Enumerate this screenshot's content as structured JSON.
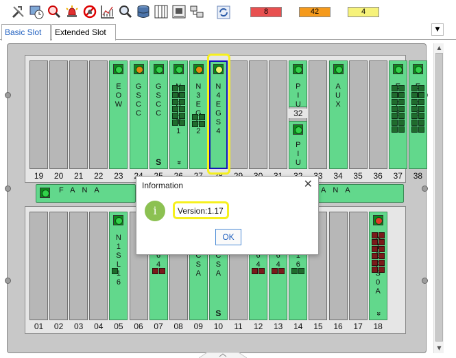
{
  "toolbar": {
    "icons": [
      "tools-icon",
      "clock-monitor-icon",
      "alarm-search-icon",
      "alarm-bell-icon",
      "alarm-filter-icon",
      "performance-chart-icon",
      "search-icon",
      "database-icon",
      "columns-icon",
      "config-icon",
      "network-icon",
      "refresh-icon"
    ],
    "alarms": {
      "critical": {
        "count": "8",
        "color": "#e85050"
      },
      "major": {
        "count": "42",
        "color": "#f59a1c"
      },
      "minor": {
        "count": "4",
        "color": "#f6f27a"
      }
    }
  },
  "tabs": {
    "basic": "Basic Slot",
    "extended": "Extended Slot"
  },
  "chassis": {
    "top_slot_numbers": [
      "19",
      "20",
      "21",
      "22",
      "23",
      "24",
      "25",
      "26",
      "27",
      "28",
      "29",
      "30",
      "31",
      "32",
      "33",
      "34",
      "35",
      "36",
      "37",
      "38"
    ],
    "bottom_slot_numbers": [
      "01",
      "02",
      "03",
      "04",
      "05",
      "06",
      "07",
      "08",
      "09",
      "10",
      "11",
      "12",
      "13",
      "14",
      "15",
      "16",
      "17",
      "18"
    ],
    "top_boards": [
      {
        "slot": "23",
        "label": "EOW",
        "led": "green"
      },
      {
        "slot": "24",
        "label": "GSCC",
        "led": "orange"
      },
      {
        "slot": "25",
        "label": "GSCC",
        "led": "green",
        "mark": "S"
      },
      {
        "slot": "26",
        "label": "N1SLT1",
        "led": "green",
        "chevron": "»"
      },
      {
        "slot": "27",
        "label": "N3EGS2",
        "led": "orange"
      },
      {
        "slot": "28",
        "label": "N4EGS4",
        "led": "yellow"
      },
      {
        "slot": "32",
        "label": "PIU",
        "led": "green"
      },
      {
        "slot": "33",
        "label": "PIU",
        "led": "green"
      },
      {
        "slot": "34",
        "label": "AUX",
        "led": "green"
      },
      {
        "slot": "37",
        "label": "ETF8",
        "led": "green"
      },
      {
        "slot": "38",
        "label": "ETF8",
        "led": "green"
      }
    ],
    "piu_slot_label": "32",
    "fans": [
      "FANA",
      "FANA"
    ],
    "bottom_boards": [
      {
        "slot": "05",
        "label": "N1SL16",
        "led": "green"
      },
      {
        "slot": "07",
        "label": "SL64",
        "led": "green"
      },
      {
        "slot": "09",
        "label": "UXCSA",
        "led": "green"
      },
      {
        "slot": "10",
        "label": "UXCSA",
        "led": "green",
        "mark": "S"
      },
      {
        "slot": "12",
        "label": "SL64",
        "led": "green"
      },
      {
        "slot": "13",
        "label": "SL64",
        "led": "green"
      },
      {
        "slot": "14",
        "label": "SL16",
        "led": "green"
      },
      {
        "slot": "18",
        "label": "N1EFS0A",
        "led": "red",
        "chevron": "»"
      }
    ]
  },
  "dialog": {
    "title": "Information",
    "close_glyph": "✕",
    "icon_glyph": "i",
    "message": "Version:1.17",
    "ok_label": "OK"
  }
}
